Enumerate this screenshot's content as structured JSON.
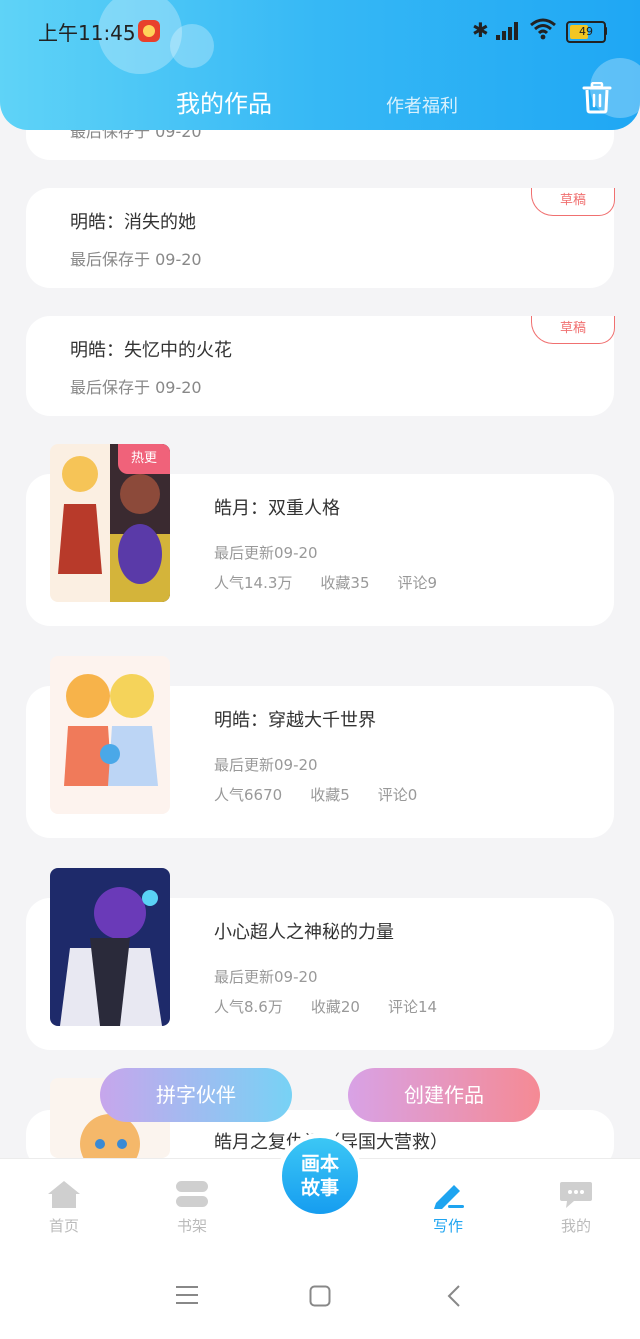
{
  "status_bar": {
    "time": "上午11:45",
    "battery": "49"
  },
  "header": {
    "active_tab": "我的作品",
    "other_tab": "作者福利"
  },
  "partial_top": {
    "meta": "最后保存于 09-20"
  },
  "drafts": [
    {
      "title": "明皓：消失的她",
      "meta": "最后保存于 09-20",
      "badge": "草稿"
    },
    {
      "title": "明皓：失忆中的火花",
      "meta": "最后保存于 09-20",
      "badge": "草稿"
    }
  ],
  "works": [
    {
      "title": "皓月：双重人格",
      "updated": "最后更新09-20",
      "popularity": "人气14.3万",
      "favorites": "收藏35",
      "comments": "评论9",
      "badge": "热更"
    },
    {
      "title": "明皓：穿越大千世界",
      "updated": "最后更新09-20",
      "popularity": "人气6670",
      "favorites": "收藏5",
      "comments": "评论0"
    },
    {
      "title": "小心超人之神秘的力量",
      "updated": "最后更新09-20",
      "popularity": "人气8.6万",
      "favorites": "收藏20",
      "comments": "评论14"
    },
    {
      "title": "皓月之复仇记（异国大营救）"
    }
  ],
  "float_buttons": {
    "partner": "拼字伙伴",
    "create": "创建作品"
  },
  "bottom_nav": {
    "home": "首页",
    "shelf": "书架",
    "center_line1": "画本",
    "center_line2": "故事",
    "write": "写作",
    "mine": "我的"
  },
  "colors": {
    "accent": "#1ea4f0",
    "draft_badge": "#f07070",
    "hot_badge": "#f0627a"
  }
}
